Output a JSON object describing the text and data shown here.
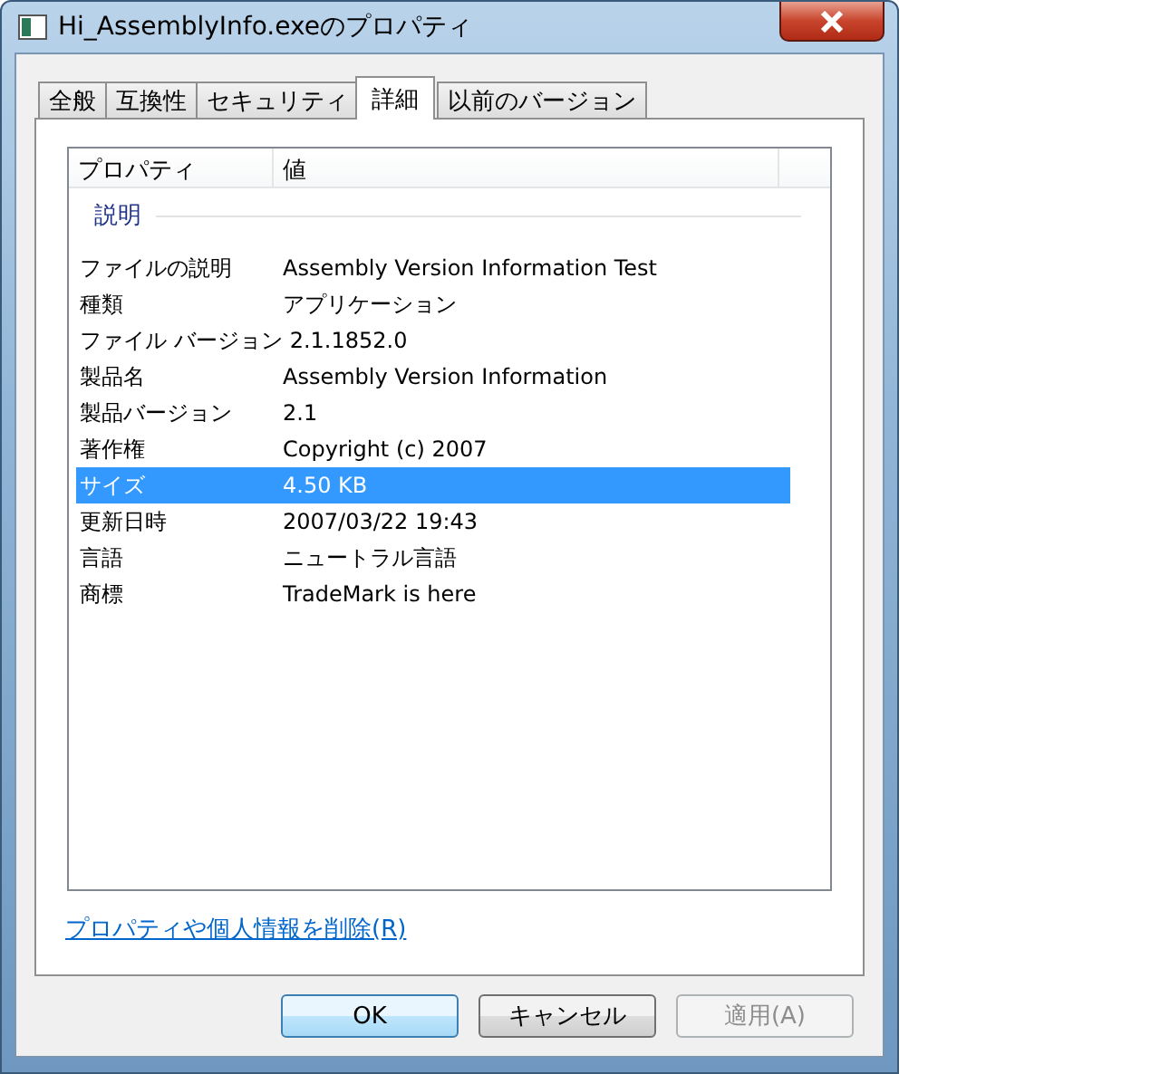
{
  "window": {
    "title": "Hi_AssemblyInfo.exeのプロパティ"
  },
  "tabs": [
    {
      "label": "全般",
      "selected": false
    },
    {
      "label": "互換性",
      "selected": false
    },
    {
      "label": "セキュリティ",
      "selected": false
    },
    {
      "label": "詳細",
      "selected": true
    },
    {
      "label": "以前のバージョン",
      "selected": false
    }
  ],
  "table": {
    "columns": [
      "プロパティ",
      "値"
    ],
    "section": "説明",
    "rows": [
      {
        "property": "ファイルの説明",
        "value": "Assembly Version Information Test",
        "selected": false
      },
      {
        "property": "種類",
        "value": "アプリケーション",
        "selected": false
      },
      {
        "property": "ファイル バージョン",
        "value": "2.1.1852.0",
        "selected": false
      },
      {
        "property": "製品名",
        "value": "Assembly Version Information",
        "selected": false
      },
      {
        "property": "製品バージョン",
        "value": "2.1",
        "selected": false
      },
      {
        "property": "著作権",
        "value": "Copyright (c) 2007",
        "selected": false
      },
      {
        "property": "サイズ",
        "value": "4.50 KB",
        "selected": true
      },
      {
        "property": "更新日時",
        "value": "2007/03/22 19:43",
        "selected": false
      },
      {
        "property": "言語",
        "value": "ニュートラル言語",
        "selected": false
      },
      {
        "property": "商標",
        "value": "TradeMark is here",
        "selected": false
      }
    ]
  },
  "link": "プロパティや個人情報を削除(R)",
  "buttons": [
    {
      "label": "OK",
      "default": true,
      "disabled": false
    },
    {
      "label": "キャンセル",
      "default": false,
      "disabled": false
    },
    {
      "label": "適用(A)",
      "default": false,
      "disabled": true
    }
  ]
}
